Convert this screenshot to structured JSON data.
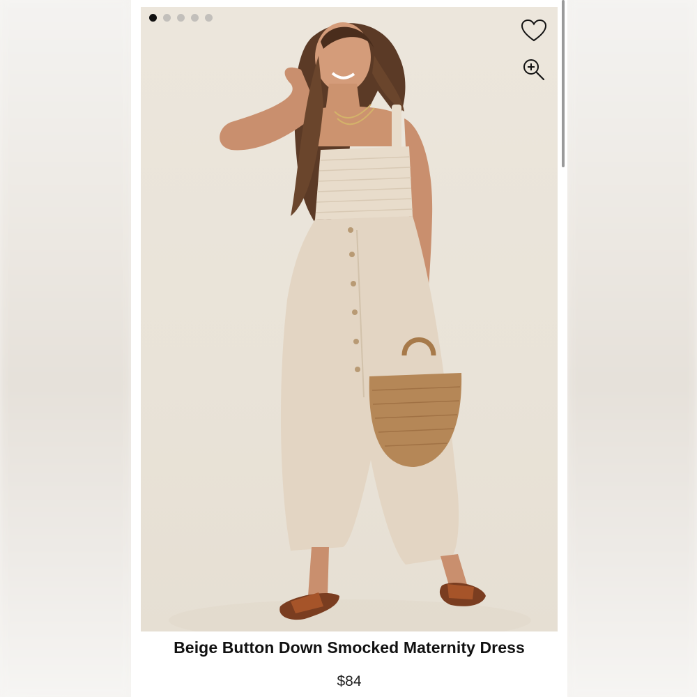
{
  "carousel": {
    "total_images": 5,
    "active_index": 0
  },
  "product": {
    "title": "Beige Button Down Smocked Maternity Dress",
    "price": "$84",
    "image_alt": "Model wearing beige button down smocked maternity dress holding a straw handbag"
  },
  "icons": {
    "favorite": "heart-outline-icon",
    "zoom": "zoom-in-icon"
  },
  "colors": {
    "photo_background": "#ece6dc",
    "dress": "#e3d5c3",
    "bag": "#b58757",
    "text": "#111111"
  }
}
